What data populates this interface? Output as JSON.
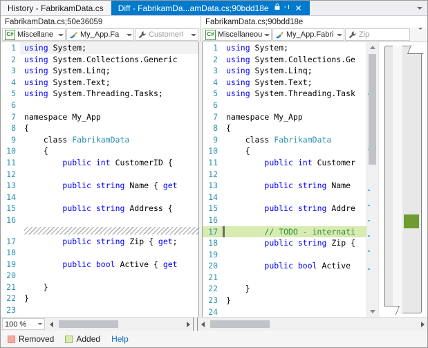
{
  "window": {
    "tabs": [
      {
        "label": "History - FabrikamData.cs",
        "active": false
      },
      {
        "label": "Diff - FabrikamDa...amData.cs;90bdd18e",
        "active": true
      }
    ],
    "tab_icons": {
      "pin": "pin-icon",
      "close": "close-icon",
      "lock": "lock-icon"
    },
    "tab_overflow_icon": "chevron-down-icon"
  },
  "left_pane": {
    "header": "FabrikamData.cs;50e36059",
    "toolbar": [
      {
        "icon": "csharp-file-icon",
        "text": "Miscellane",
        "dim": false
      },
      {
        "icon": "method-icon",
        "text": "My_App.Fa",
        "dim": false
      },
      {
        "icon": "property-icon",
        "text": "CustomerI",
        "dim": true
      }
    ],
    "lines": [
      {
        "num": "1",
        "caret": true,
        "tokens": [
          {
            "t": "using",
            "c": "kw"
          },
          {
            "t": " System;",
            "c": "pl"
          }
        ]
      },
      {
        "num": "2",
        "tokens": [
          {
            "t": "using",
            "c": "kw"
          },
          {
            "t": " System.Collections.Generic",
            "c": "pl"
          }
        ]
      },
      {
        "num": "3",
        "tokens": [
          {
            "t": "using",
            "c": "kw"
          },
          {
            "t": " System.Linq;",
            "c": "pl"
          }
        ]
      },
      {
        "num": "4",
        "tokens": [
          {
            "t": "using",
            "c": "kw"
          },
          {
            "t": " System.Text;",
            "c": "pl"
          }
        ]
      },
      {
        "num": "5",
        "tokens": [
          {
            "t": "using",
            "c": "kw"
          },
          {
            "t": " System.Threading.Tasks;",
            "c": "pl"
          }
        ]
      },
      {
        "num": "6",
        "tokens": []
      },
      {
        "num": "7",
        "tokens": [
          {
            "t": "namespace My_App",
            "c": "pl"
          }
        ]
      },
      {
        "num": "8",
        "tokens": [
          {
            "t": "{",
            "c": "pl"
          }
        ]
      },
      {
        "num": "9",
        "tokens": [
          {
            "t": "    class ",
            "c": "pl"
          },
          {
            "t": "FabrikamData",
            "c": "ty"
          }
        ]
      },
      {
        "num": "10",
        "tokens": [
          {
            "t": "    {",
            "c": "pl"
          }
        ]
      },
      {
        "num": "11",
        "tokens": [
          {
            "t": "        ",
            "c": "pl"
          },
          {
            "t": "public",
            "c": "kw"
          },
          {
            "t": " ",
            "c": "pl"
          },
          {
            "t": "int",
            "c": "kw"
          },
          {
            "t": " CustomerID {",
            "c": "pl"
          }
        ]
      },
      {
        "num": "12",
        "tokens": []
      },
      {
        "num": "13",
        "tokens": [
          {
            "t": "        ",
            "c": "pl"
          },
          {
            "t": "public",
            "c": "kw"
          },
          {
            "t": " ",
            "c": "pl"
          },
          {
            "t": "string",
            "c": "kw"
          },
          {
            "t": " Name { ",
            "c": "pl"
          },
          {
            "t": "get",
            "c": "kw"
          }
        ]
      },
      {
        "num": "14",
        "tokens": []
      },
      {
        "num": "15",
        "tokens": [
          {
            "t": "        ",
            "c": "pl"
          },
          {
            "t": "public",
            "c": "kw"
          },
          {
            "t": " ",
            "c": "pl"
          },
          {
            "t": "string",
            "c": "kw"
          },
          {
            "t": " Address {",
            "c": "pl"
          }
        ]
      },
      {
        "num": "16",
        "tokens": []
      },
      {
        "num": "__hatch__",
        "hatch": true
      },
      {
        "num": "17",
        "tokens": [
          {
            "t": "        ",
            "c": "pl"
          },
          {
            "t": "public",
            "c": "kw"
          },
          {
            "t": " ",
            "c": "pl"
          },
          {
            "t": "string",
            "c": "kw"
          },
          {
            "t": " Zip { ",
            "c": "pl"
          },
          {
            "t": "get",
            "c": "kw"
          },
          {
            "t": ";",
            "c": "pl"
          }
        ]
      },
      {
        "num": "18",
        "tokens": []
      },
      {
        "num": "19",
        "tokens": [
          {
            "t": "        ",
            "c": "pl"
          },
          {
            "t": "public",
            "c": "kw"
          },
          {
            "t": " ",
            "c": "pl"
          },
          {
            "t": "bool",
            "c": "kw"
          },
          {
            "t": " Active { ",
            "c": "pl"
          },
          {
            "t": "get",
            "c": "kw"
          }
        ]
      },
      {
        "num": "20",
        "tokens": []
      },
      {
        "num": "21",
        "tokens": [
          {
            "t": "    }",
            "c": "pl"
          }
        ]
      },
      {
        "num": "22",
        "tokens": [
          {
            "t": "}",
            "c": "pl"
          }
        ]
      },
      {
        "num": "23",
        "tokens": []
      }
    ],
    "zoom": "100 %",
    "zoom_caret_icon": "chevron-down-icon"
  },
  "right_pane": {
    "header": "FabrikamData.cs;90bdd18e",
    "toolbar": [
      {
        "icon": "csharp-file-icon",
        "text": "Miscellaneous",
        "dim": false
      },
      {
        "icon": "method-icon",
        "text": "My_App.Fabri",
        "dim": false
      },
      {
        "icon": "property-icon",
        "text": "Zip",
        "dim": true
      }
    ],
    "toolbar_overflow_icon": "chevron-down-icon",
    "lines": [
      {
        "num": "1",
        "tokens": [
          {
            "t": "using",
            "c": "kw"
          },
          {
            "t": " System;",
            "c": "pl"
          }
        ]
      },
      {
        "num": "2",
        "tokens": [
          {
            "t": "using",
            "c": "kw"
          },
          {
            "t": " System.Collections.Ge",
            "c": "pl"
          }
        ]
      },
      {
        "num": "3",
        "tokens": [
          {
            "t": "using",
            "c": "kw"
          },
          {
            "t": " System.Linq;",
            "c": "pl"
          }
        ]
      },
      {
        "num": "4",
        "tokens": [
          {
            "t": "using",
            "c": "kw"
          },
          {
            "t": " System.Text;",
            "c": "pl"
          }
        ]
      },
      {
        "num": "5",
        "tokens": [
          {
            "t": "using",
            "c": "kw"
          },
          {
            "t": " System.Threading.Task",
            "c": "pl"
          }
        ]
      },
      {
        "num": "6",
        "tokens": []
      },
      {
        "num": "7",
        "tokens": [
          {
            "t": "namespace My_App",
            "c": "pl"
          }
        ]
      },
      {
        "num": "8",
        "tokens": [
          {
            "t": "{",
            "c": "pl"
          }
        ]
      },
      {
        "num": "9",
        "tokens": [
          {
            "t": "    class ",
            "c": "pl"
          },
          {
            "t": "FabrikamData",
            "c": "ty"
          }
        ]
      },
      {
        "num": "10",
        "tokens": [
          {
            "t": "    {",
            "c": "pl"
          }
        ]
      },
      {
        "num": "11",
        "tokens": [
          {
            "t": "        ",
            "c": "pl"
          },
          {
            "t": "public",
            "c": "kw"
          },
          {
            "t": " ",
            "c": "pl"
          },
          {
            "t": "int",
            "c": "kw"
          },
          {
            "t": " Customer",
            "c": "pl"
          }
        ]
      },
      {
        "num": "12",
        "tokens": []
      },
      {
        "num": "13",
        "tokens": [
          {
            "t": "        ",
            "c": "pl"
          },
          {
            "t": "public",
            "c": "kw"
          },
          {
            "t": " ",
            "c": "pl"
          },
          {
            "t": "string",
            "c": "kw"
          },
          {
            "t": " Name",
            "c": "pl"
          }
        ]
      },
      {
        "num": "14",
        "tokens": []
      },
      {
        "num": "15",
        "tokens": [
          {
            "t": "        ",
            "c": "pl"
          },
          {
            "t": "public",
            "c": "kw"
          },
          {
            "t": " ",
            "c": "pl"
          },
          {
            "t": "string",
            "c": "kw"
          },
          {
            "t": " Addre",
            "c": "pl"
          }
        ]
      },
      {
        "num": "16",
        "tokens": []
      },
      {
        "num": "17",
        "added": true,
        "tokens": [
          {
            "t": "        // TODO - internati",
            "c": "cm"
          }
        ]
      },
      {
        "num": "18",
        "tokens": [
          {
            "t": "        ",
            "c": "pl"
          },
          {
            "t": "public",
            "c": "kw"
          },
          {
            "t": " ",
            "c": "pl"
          },
          {
            "t": "string",
            "c": "kw"
          },
          {
            "t": " Zip {",
            "c": "pl"
          }
        ]
      },
      {
        "num": "19",
        "tokens": []
      },
      {
        "num": "20",
        "tokens": [
          {
            "t": "        ",
            "c": "pl"
          },
          {
            "t": "public",
            "c": "kw"
          },
          {
            "t": " ",
            "c": "pl"
          },
          {
            "t": "bool",
            "c": "kw"
          },
          {
            "t": " Active",
            "c": "pl"
          }
        ]
      },
      {
        "num": "21",
        "tokens": []
      },
      {
        "num": "22",
        "tokens": [
          {
            "t": "    }",
            "c": "pl"
          }
        ]
      },
      {
        "num": "23",
        "tokens": [
          {
            "t": "}",
            "c": "pl"
          }
        ]
      },
      {
        "num": "24",
        "tokens": []
      }
    ]
  },
  "scrollbar": {
    "up_icon": "scroll-up-arrow-icon",
    "down_icon": "scroll-down-arrow-icon",
    "left_icon": "scroll-left-arrow-icon",
    "right_icon": "scroll-right-arrow-icon"
  },
  "overview_margin": {
    "marker_color": "#6f9b2f",
    "marker_name": "added-change-marker"
  },
  "legend": {
    "removed_label": "Removed",
    "removed_color": "#f7a8a0",
    "added_label": "Added",
    "added_color": "#d8ebb0",
    "help_label": "Help",
    "help_color": "#0f6cbd"
  }
}
